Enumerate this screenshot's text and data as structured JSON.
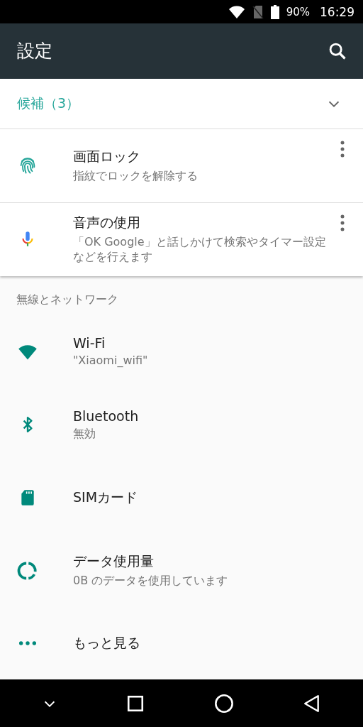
{
  "status_bar": {
    "battery": "90%",
    "time": "16:29"
  },
  "app_bar": {
    "title": "設定"
  },
  "suggestions": {
    "header": "候補（3）",
    "items": [
      {
        "kind": "fingerprint",
        "title": "画面ロック",
        "summary": "指紋でロックを解除する"
      },
      {
        "kind": "mic",
        "title": "音声の使用",
        "summary": "「OK Google」と話しかけて検索やタイマー設定などを行えます"
      }
    ]
  },
  "section": {
    "header": "無線とネットワーク",
    "items": [
      {
        "kind": "wifi",
        "title": "Wi-Fi",
        "summary": "\"Xiaomi_wifi\""
      },
      {
        "kind": "bluetooth",
        "title": "Bluetooth",
        "summary": "無効"
      },
      {
        "kind": "sim",
        "title": "SIMカード"
      },
      {
        "kind": "data",
        "title": "データ使用量",
        "summary": "0B のデータを使用しています"
      },
      {
        "kind": "more",
        "title": "もっと見る"
      }
    ]
  }
}
